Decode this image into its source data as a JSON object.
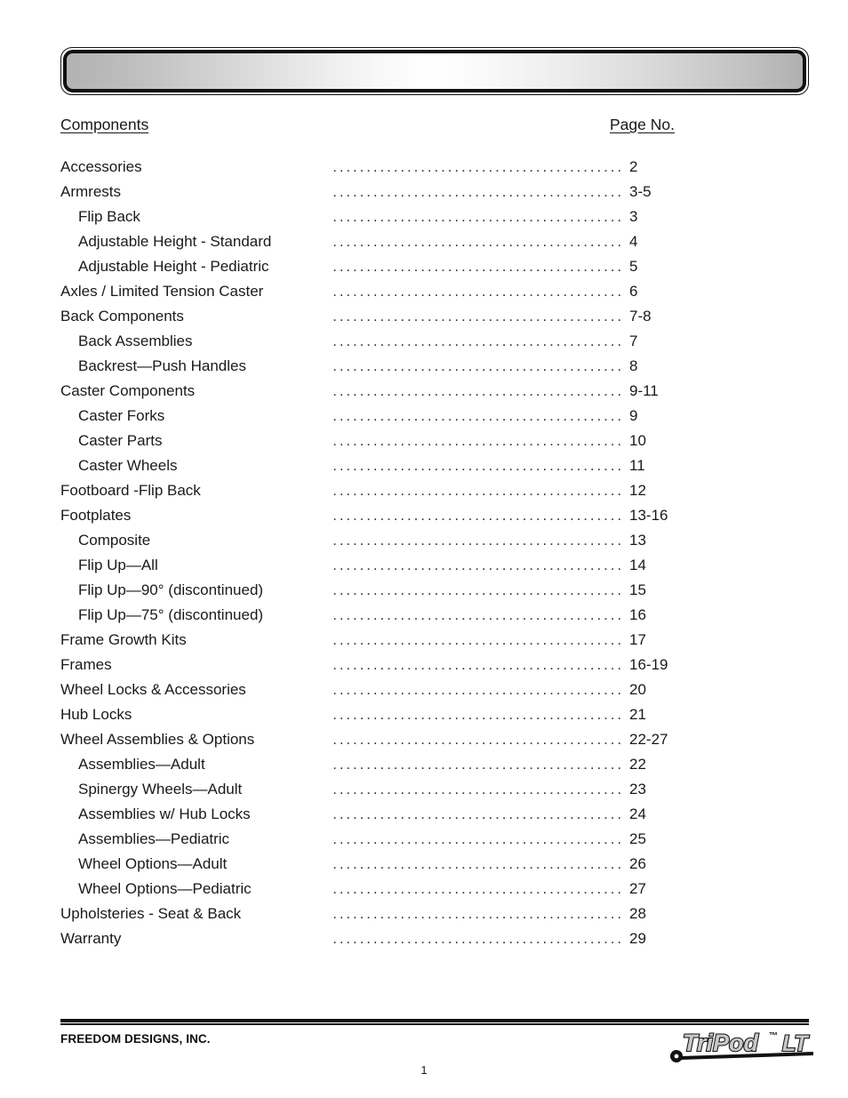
{
  "banner": {
    "title": ""
  },
  "headers": {
    "components": "Components",
    "page_no": "Page No."
  },
  "toc": {
    "leader_dots": "..................................................",
    "entries": [
      {
        "label": "Accessories",
        "page": "2",
        "level": 0
      },
      {
        "label": "Armrests",
        "page": "3-5",
        "level": 0
      },
      {
        "label": "Flip Back",
        "page": "3",
        "level": 1
      },
      {
        "label": "Adjustable Height - Standard",
        "page": "4",
        "level": 1
      },
      {
        "label": "Adjustable Height - Pediatric",
        "page": "5",
        "level": 1
      },
      {
        "label": "Axles / Limited Tension Caster",
        "page": "6",
        "level": 0
      },
      {
        "label": "Back Components",
        "page": "7-8",
        "level": 0
      },
      {
        "label": "Back Assemblies",
        "page": "7",
        "level": 1
      },
      {
        "label": "Backrest—Push Handles",
        "page": "8",
        "level": 1
      },
      {
        "label": "Caster Components",
        "page": "9-11",
        "level": 0
      },
      {
        "label": "Caster Forks",
        "page": "9",
        "level": 1
      },
      {
        "label": "Caster Parts",
        "page": "10",
        "level": 1
      },
      {
        "label": "Caster Wheels",
        "page": "11",
        "level": 1
      },
      {
        "label": "Footboard -Flip Back",
        "page": "12",
        "level": 0
      },
      {
        "label": "Footplates",
        "page": "13-16",
        "level": 0
      },
      {
        "label": "Composite",
        "page": "13",
        "level": 1
      },
      {
        "label": "Flip Up—All",
        "page": "14",
        "level": 1
      },
      {
        "label": "Flip Up—90° (discontinued)",
        "page": "15",
        "level": 1
      },
      {
        "label": "Flip Up—75° (discontinued)",
        "page": "16",
        "level": 1
      },
      {
        "label": "Frame Growth Kits",
        "page": "17",
        "level": 0
      },
      {
        "label": "Frames",
        "page": "16-19",
        "level": 0
      },
      {
        "label": "Wheel Locks & Accessories",
        "page": "20",
        "level": 0
      },
      {
        "label": "Hub Locks",
        "page": "21",
        "level": 0
      },
      {
        "label": "Wheel Assemblies & Options",
        "page": "22-27",
        "level": 0
      },
      {
        "label": "Assemblies—Adult",
        "page": "22",
        "level": 1
      },
      {
        "label": "Spinergy Wheels—Adult",
        "page": "23",
        "level": 1
      },
      {
        "label": "Assemblies w/ Hub Locks",
        "page": "24",
        "level": 1
      },
      {
        "label": "Assemblies—Pediatric",
        "page": "25",
        "level": 1
      },
      {
        "label": "Wheel Options—Adult",
        "page": "26",
        "level": 1
      },
      {
        "label": "Wheel Options—Pediatric",
        "page": "27",
        "level": 1
      },
      {
        "label": "Upholsteries - Seat & Back",
        "page": "28",
        "level": 0
      },
      {
        "label": "Warranty",
        "page": "29",
        "level": 0
      }
    ]
  },
  "footer": {
    "company": "FREEDOM DESIGNS, INC.",
    "page_number": "1",
    "logo": {
      "brand": "TriPod",
      "trademark": "™",
      "model": "LT"
    }
  },
  "colors": {
    "ink": "#1a1a1a",
    "rule": "#111111",
    "banner_edge": "#b0b0b0",
    "banner_center": "#ffffff",
    "logo_fill": "#c8c8c8",
    "logo_outline": "#111111"
  }
}
